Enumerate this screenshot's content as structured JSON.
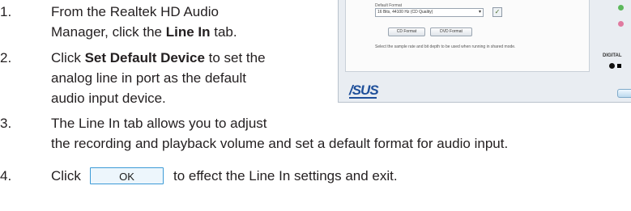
{
  "steps": [
    {
      "number": "1.",
      "lines": [
        "From the Realtek HD Audio",
        "Manager, click the ",
        "Line In",
        " tab."
      ]
    },
    {
      "number": "2.",
      "lines": [
        "Click ",
        "Set Default Device",
        " to set the",
        "analog line in port as the default",
        "audio input device."
      ]
    },
    {
      "number": "3.",
      "lines": [
        "The Line In tab allows you to adjust",
        "the recording and playback volume and set a default format for audio input."
      ]
    },
    {
      "number": "4.",
      "before": "Click",
      "button_label": "OK",
      "after": "to effect the Line In settings and exit."
    }
  ],
  "screenshot": {
    "format_label": "Default Format",
    "format_value": "16 Bits, 44100 Hz (CD Quality)",
    "check_icon": "checkmark-icon",
    "button_1": "CD Format",
    "button_2": "DVD Format",
    "hint_text": "Select the sample rate and bit depth to be used when running in shared mode.",
    "logo": "/SUS",
    "side_label": "DIGITAL",
    "colors": {
      "green_dot": "#5cb85c",
      "pink_dot": "#e07aa0",
      "logo_blue": "#1e4f9a",
      "ok_border": "#3c9bd7"
    }
  }
}
